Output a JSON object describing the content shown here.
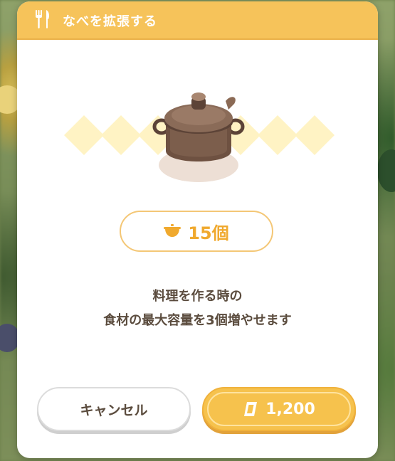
{
  "dialog": {
    "title": "なべを拡張する",
    "header_icon": "fork-knife-icon",
    "item_icon": "cooking-pot-icon"
  },
  "capacity": {
    "icon": "bowl-icon",
    "label": "15個"
  },
  "description": {
    "line1": "料理を作る時の",
    "line2": "食材の最大容量を3個増やせます"
  },
  "buttons": {
    "cancel_label": "キャンセル",
    "buy_label": "1,200",
    "buy_icon": "gold-coin-icon"
  },
  "colors": {
    "accent": "#f6c35a",
    "text": "#5b4c3e",
    "capacity_text": "#f0a92e"
  }
}
